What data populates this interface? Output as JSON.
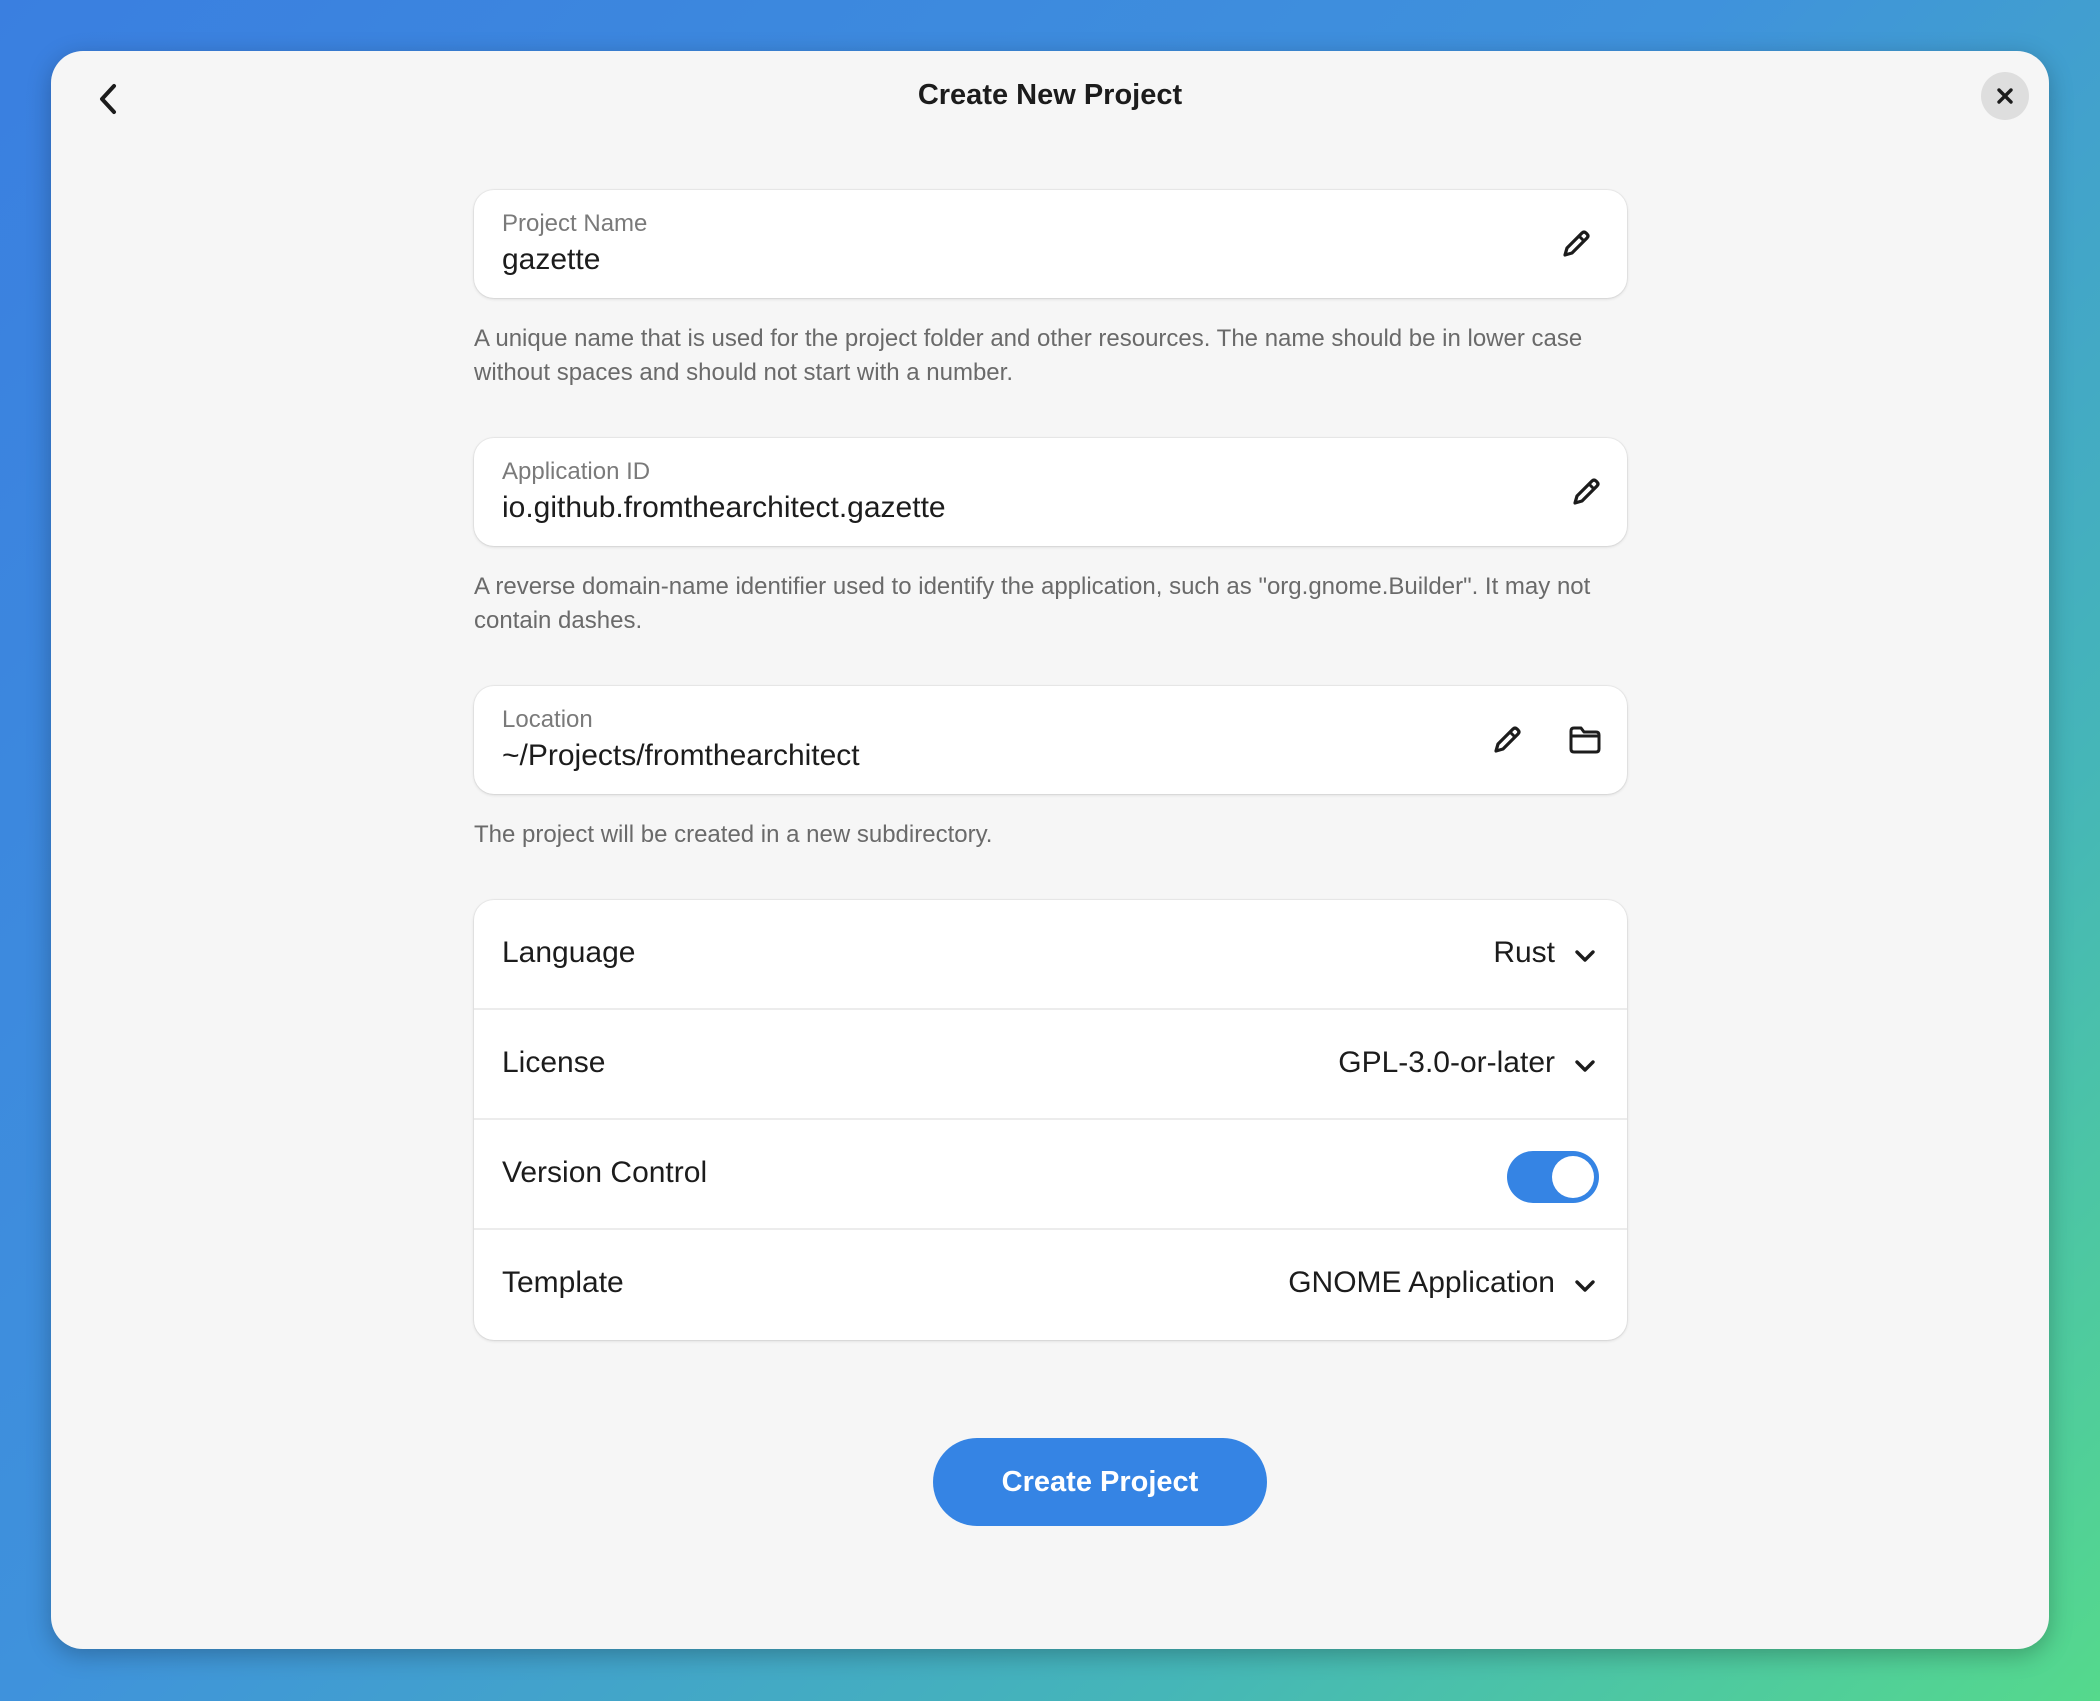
{
  "window": {
    "title": "Create New Project"
  },
  "icons": {
    "back": "chevron-left-icon",
    "close": "close-icon",
    "edit": "pencil-icon",
    "folder": "folder-icon",
    "dropdown": "chevron-down-icon"
  },
  "fields": {
    "project_name": {
      "label": "Project Name",
      "value": "gazette",
      "hint": "A unique name that is used for the project folder and other resources. The name should be in lower case without spaces and should not start with a number."
    },
    "application_id": {
      "label": "Application ID",
      "value": "io.github.fromthearchitect.gazette",
      "hint": "A reverse domain-name identifier used to identify the application, such as \"org.gnome.Builder\". It may not contain dashes."
    },
    "location": {
      "label": "Location",
      "value": "~/Projects/fromthearchitect",
      "hint": "The project will be created in a new subdirectory."
    }
  },
  "options": {
    "language": {
      "label": "Language",
      "value": "Rust"
    },
    "license": {
      "label": "License",
      "value": "GPL-3.0-or-later"
    },
    "version_control": {
      "label": "Version Control",
      "enabled": true
    },
    "template": {
      "label": "Template",
      "value": "GNOME Application"
    }
  },
  "actions": {
    "create_label": "Create Project"
  },
  "colors": {
    "accent": "#3584e4",
    "window_bg": "#f6f6f6",
    "card_bg": "#ffffff"
  }
}
